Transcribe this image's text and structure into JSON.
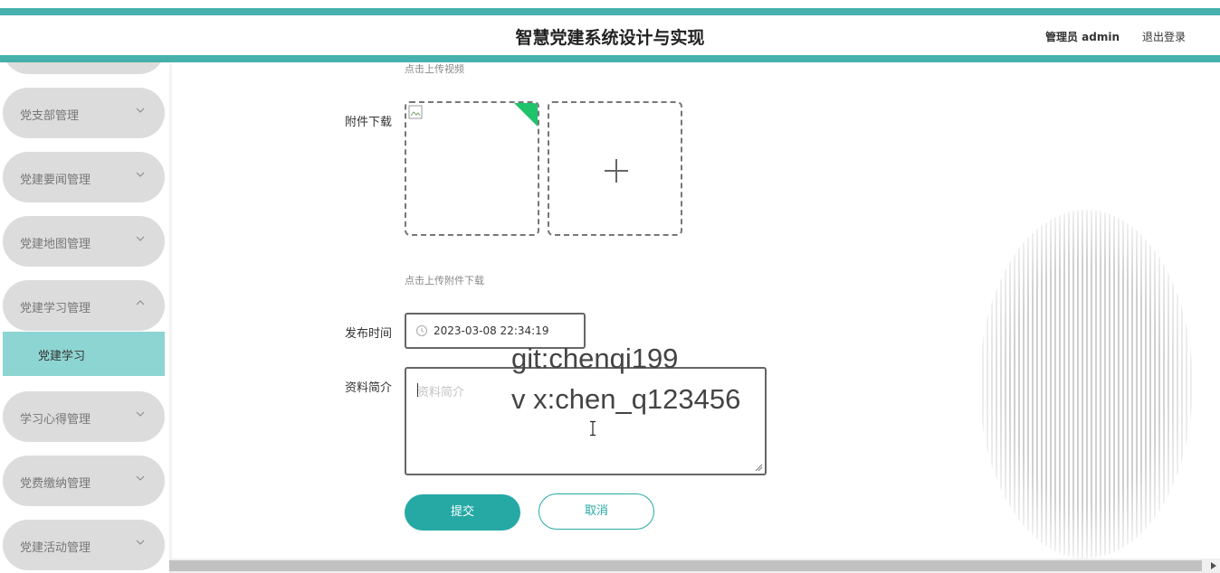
{
  "header": {
    "title": "智慧党建系统设计与实现",
    "user_label": "管理员 admin",
    "logout_label": "退出登录",
    "accent_color": "#47b2ad"
  },
  "sidebar": {
    "items": [
      {
        "label": "",
        "icon": "chevron-down-icon"
      },
      {
        "label": "党支部管理",
        "icon": "chevron-down-icon"
      },
      {
        "label": "党建要闻管理",
        "icon": "chevron-down-icon"
      },
      {
        "label": "党建地图管理",
        "icon": "chevron-down-icon"
      },
      {
        "label": "党建学习管理",
        "icon": "chevron-up-icon",
        "expanded": true
      },
      {
        "label": "学习心得管理",
        "icon": "chevron-down-icon"
      },
      {
        "label": "党费缴纳管理",
        "icon": "chevron-down-icon"
      },
      {
        "label": "党建活动管理",
        "icon": "chevron-down-icon"
      }
    ],
    "active_sub_item": {
      "label": "党建学习",
      "color": "#8dd5d2"
    }
  },
  "form": {
    "video_hint": "点击上传视频",
    "attachment": {
      "label": "附件下载",
      "hint": "点击上传附件下载"
    },
    "publish_time": {
      "label": "发布时间",
      "value": "2023-03-08 22:34:19"
    },
    "summary": {
      "label": "资料简介",
      "placeholder": "资料简介"
    },
    "submit_label": "提交",
    "cancel_label": "取消",
    "button_color": "#26a9a5"
  },
  "watermark": {
    "line1": "git:chenqi199",
    "line2": "v x:chen_q123456"
  }
}
